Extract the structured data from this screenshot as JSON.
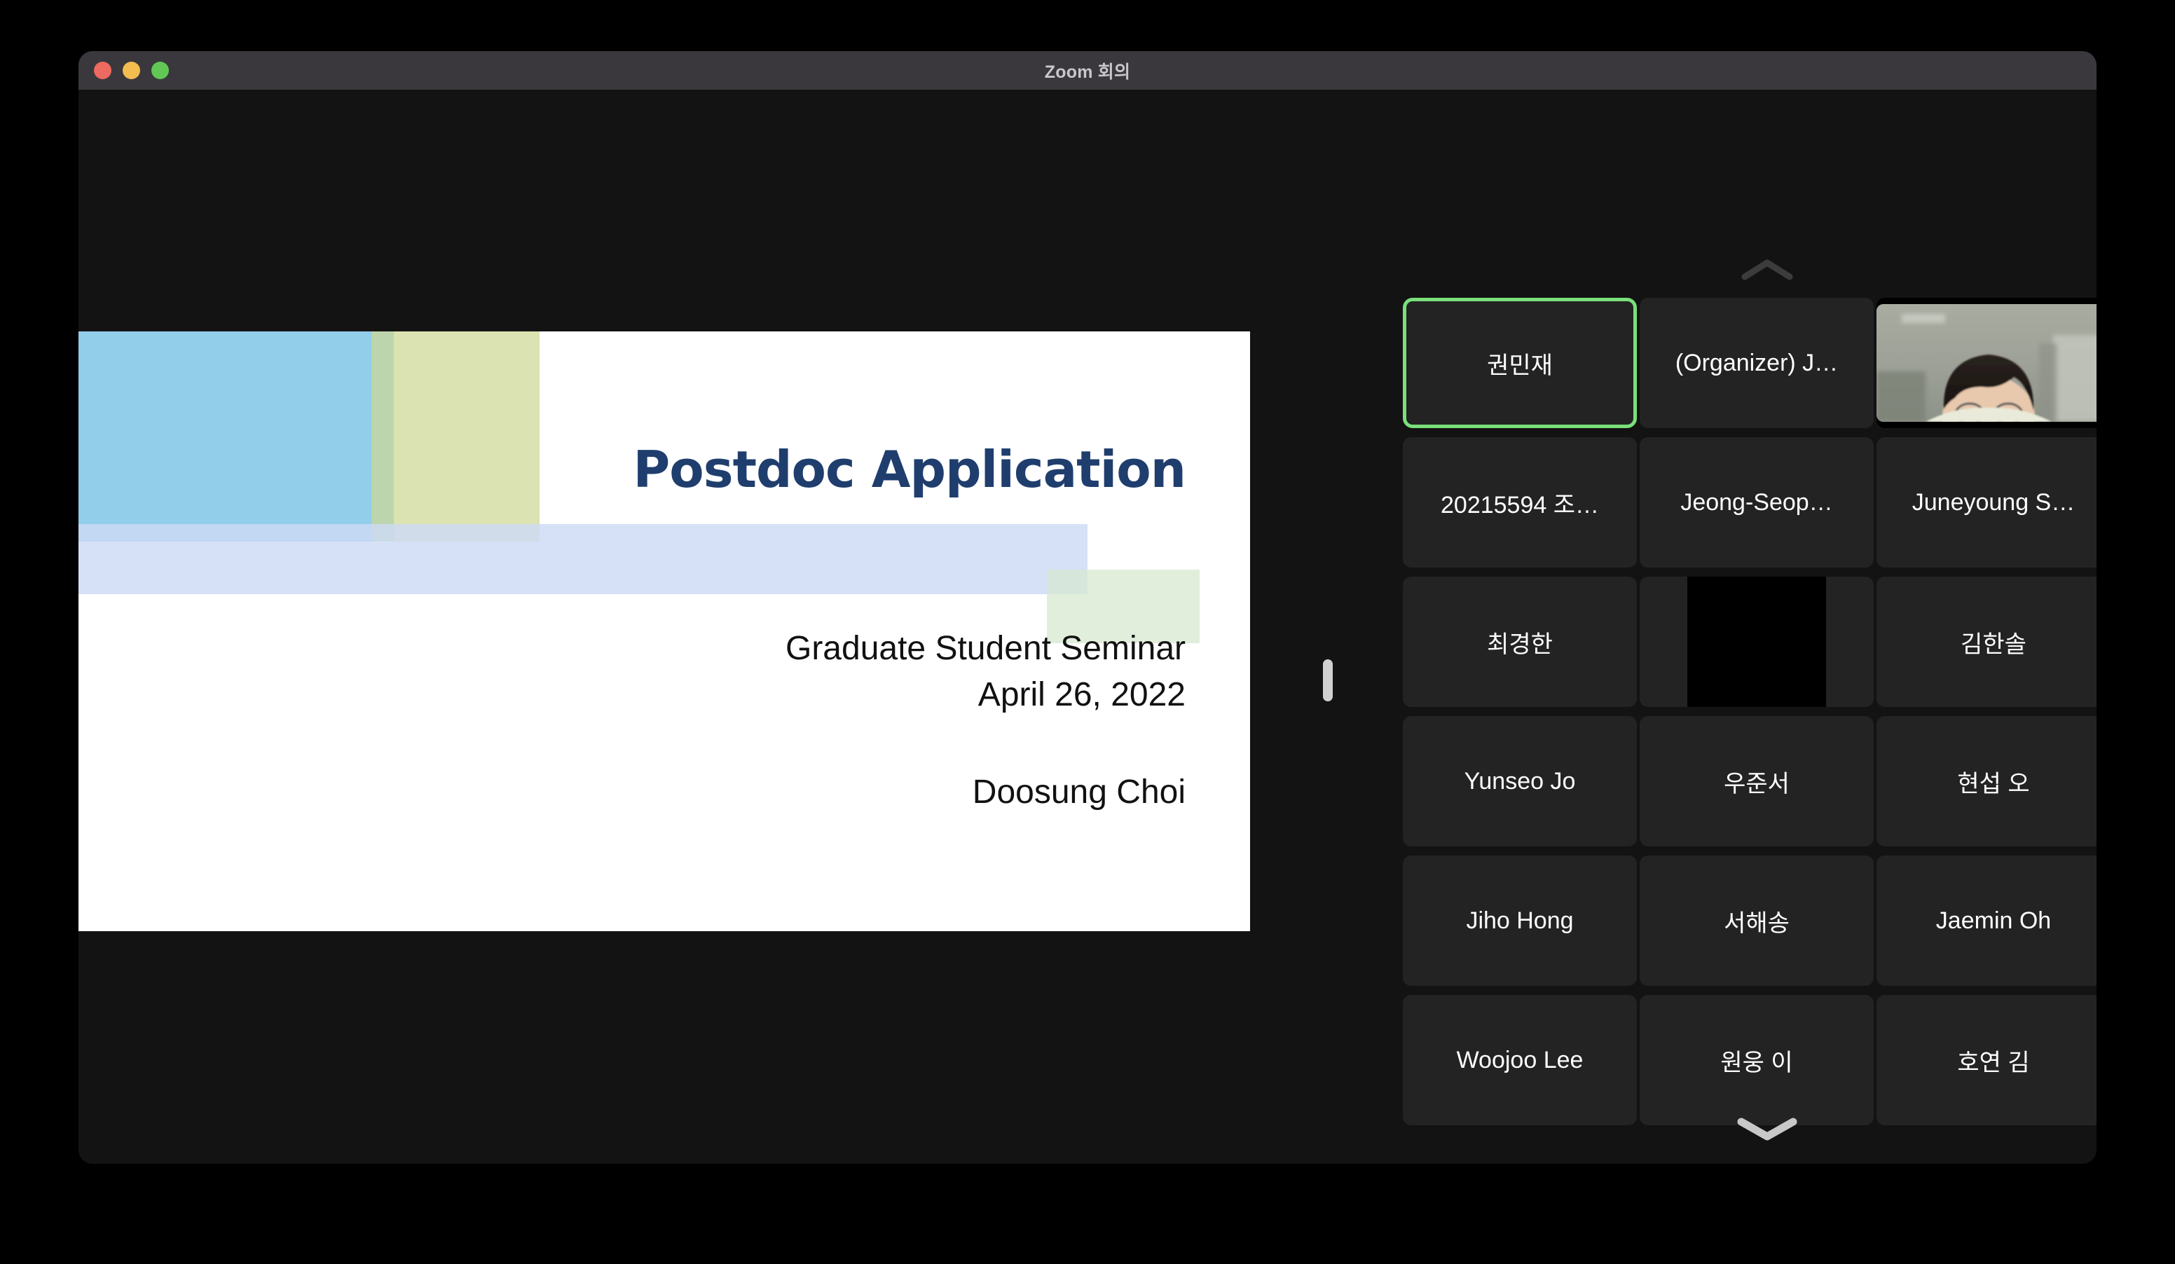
{
  "window": {
    "title": "Zoom 회의",
    "controls": [
      {
        "name": "close",
        "label": "close"
      },
      {
        "name": "minimize",
        "label": "minimize"
      },
      {
        "name": "maximize",
        "label": "maximize"
      }
    ]
  },
  "colors": {
    "titlebar": "#3a383d",
    "window_bg": "#131313",
    "tile_bg": "#232323",
    "active_speaker_border": "#7ae07a",
    "slide_title": "#1f3e6e",
    "slide_blue_block": "#6dbce2",
    "slide_olive_block": "#cdd894",
    "slide_lavender_band": "#cddbf5",
    "slide_green_block": "#d5e7cf"
  },
  "shared_slide": {
    "title": "Postdoc Application",
    "subtitle_line1": "Graduate Student Seminar",
    "subtitle_line2": "April 26, 2022",
    "presenter": "Doosung Choi"
  },
  "filmstrip": {
    "scroll_up_icon": "chevron-up-icon",
    "scroll_down_icon": "chevron-down-icon",
    "participants": [
      {
        "name": "권민재",
        "active_speaker": true,
        "video": "none"
      },
      {
        "name": "(Organizer) J…",
        "active_speaker": false,
        "video": "none"
      },
      {
        "name": "",
        "active_speaker": false,
        "video": "live"
      },
      {
        "name": "20215594 조…",
        "active_speaker": false,
        "video": "none"
      },
      {
        "name": "Jeong-Seop…",
        "active_speaker": false,
        "video": "none"
      },
      {
        "name": "Juneyoung S…",
        "active_speaker": false,
        "video": "none"
      },
      {
        "name": "최경한",
        "active_speaker": false,
        "video": "none"
      },
      {
        "name": "",
        "active_speaker": false,
        "video": "dark"
      },
      {
        "name": "김한솔",
        "active_speaker": false,
        "video": "none"
      },
      {
        "name": "Yunseo Jo",
        "active_speaker": false,
        "video": "none"
      },
      {
        "name": "우준서",
        "active_speaker": false,
        "video": "none"
      },
      {
        "name": "현섭 오",
        "active_speaker": false,
        "video": "none"
      },
      {
        "name": "Jiho Hong",
        "active_speaker": false,
        "video": "none"
      },
      {
        "name": "서해송",
        "active_speaker": false,
        "video": "none"
      },
      {
        "name": "Jaemin Oh",
        "active_speaker": false,
        "video": "none"
      },
      {
        "name": "Woojoo Lee",
        "active_speaker": false,
        "video": "none"
      },
      {
        "name": "원웅 이",
        "active_speaker": false,
        "video": "none"
      },
      {
        "name": "호연 김",
        "active_speaker": false,
        "video": "none"
      }
    ]
  }
}
